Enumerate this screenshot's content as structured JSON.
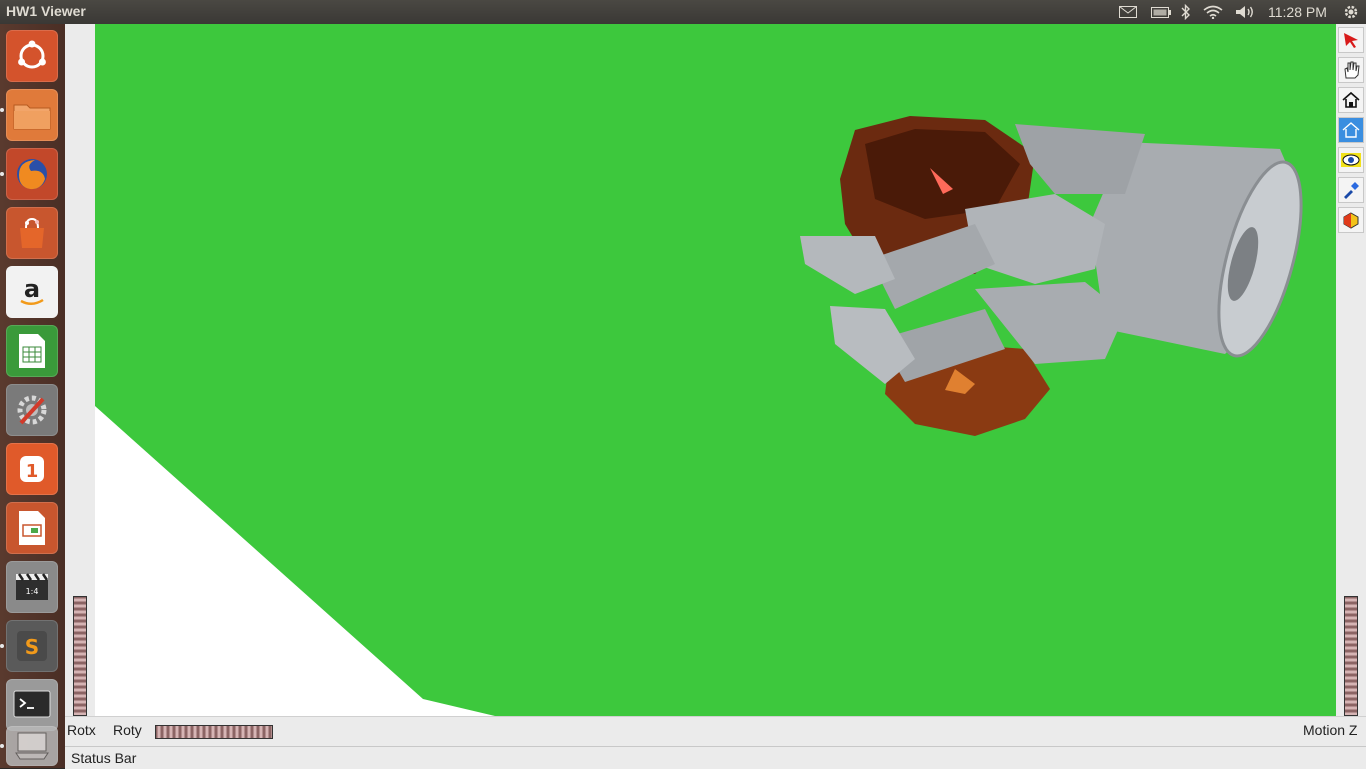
{
  "window": {
    "title": "HW1 Viewer"
  },
  "tray": {
    "icons": [
      "mail-icon",
      "battery-icon",
      "bluetooth-icon",
      "wifi-icon",
      "volume-icon",
      "settings-gear-icon"
    ],
    "clock": "11:28 PM"
  },
  "launcher": {
    "items": [
      {
        "name": "ubuntu-dash-icon"
      },
      {
        "name": "files-icon"
      },
      {
        "name": "firefox-icon"
      },
      {
        "name": "software-center-icon"
      },
      {
        "name": "amazon-icon"
      },
      {
        "name": "calc-spreadsheet-icon"
      },
      {
        "name": "system-settings-icon"
      },
      {
        "name": "ubuntu-one-icon"
      },
      {
        "name": "impress-presentation-icon"
      },
      {
        "name": "video-editor-icon"
      },
      {
        "name": "sublime-text-icon"
      },
      {
        "name": "terminal-icon"
      },
      {
        "name": "hw1-viewer-app-icon"
      }
    ]
  },
  "tools": {
    "items": [
      "select-arrow-icon",
      "hand-pan-icon",
      "home-icon",
      "set-home-icon",
      "view-eye-icon",
      "flashlight-icon",
      "projection-icon"
    ]
  },
  "controls": {
    "rotx_label": "Rotx",
    "roty_label": "Roty",
    "motionz_label": "Motion Z"
  },
  "status": {
    "text": "Status Bar"
  },
  "colors": {
    "viewport_bg": "#3dc83d",
    "floor": "#ffffff",
    "object_brown": "#6b2a10",
    "object_gray": "#a8acb0"
  }
}
